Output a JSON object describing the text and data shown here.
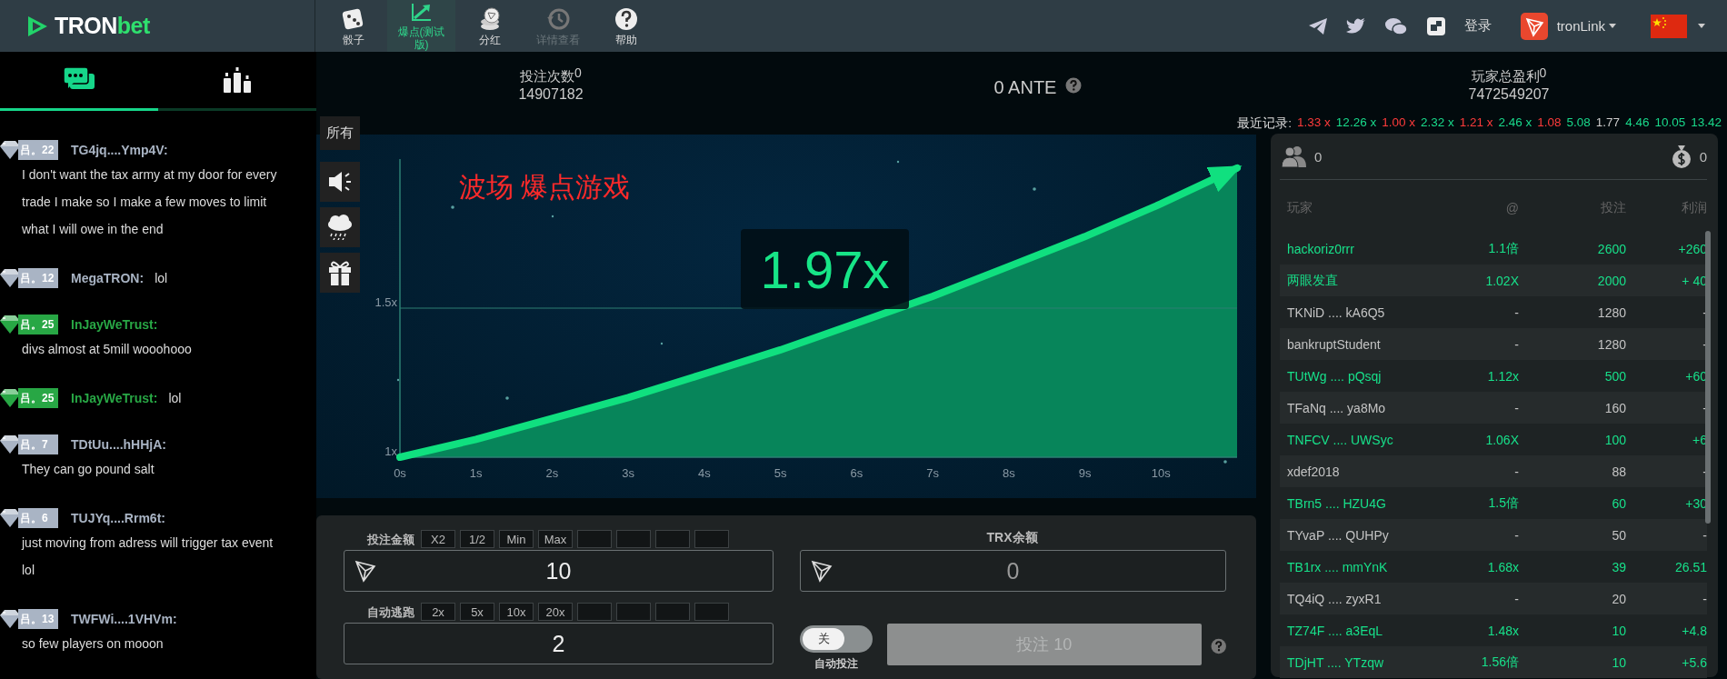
{
  "header": {
    "logo": {
      "main": "TRON",
      "accent": "bet"
    },
    "nav": [
      {
        "kind": "dice",
        "label": "骰子",
        "selected": false,
        "disabled": false
      },
      {
        "kind": "crash",
        "label": "爆点(测试版)",
        "selected": true,
        "disabled": false
      },
      {
        "kind": "coins",
        "label": "分红",
        "selected": false,
        "disabled": false
      },
      {
        "kind": "history",
        "label": "详情查看",
        "selected": false,
        "disabled": true
      },
      {
        "kind": "help",
        "label": "帮助",
        "selected": false,
        "disabled": false
      }
    ],
    "login": "登录",
    "wallet": "tronLink"
  },
  "sidebar": {
    "tabs": [
      {
        "kind": "chat",
        "selected": true
      },
      {
        "kind": "ranking",
        "selected": false
      }
    ],
    "messages": [
      {
        "level": "吕。22",
        "color": "#a9b4c4",
        "name": "TG4jq....Ymp4V:",
        "text": "I don't want the tax army at my door for every trade I make so I make a few moves to limit what I will owe in the end",
        "inline": false
      },
      {
        "level": "吕。12",
        "color": "#a9b4c4",
        "name": "MegaTRON:",
        "text": "lol",
        "inline": true
      },
      {
        "level": "吕。25",
        "color": "#28a745",
        "name": "InJayWeTrust:",
        "text": "divs almost at 5mill wooohooo",
        "inline": false
      },
      {
        "level": "吕。25",
        "color": "#28a745",
        "name": "InJayWeTrust:",
        "text": "lol",
        "inline": true
      },
      {
        "level": "吕。7",
        "color": "#a9b4c4",
        "name": "TDtUu....hHHjA:",
        "text": "They can go pound salt",
        "inline": false
      },
      {
        "level": "吕。6",
        "color": "#a9b4c4",
        "name": "TUJYq....Rrm6t:",
        "text": "just moving from adress will trigger tax event lol",
        "inline": false
      },
      {
        "level": "吕。13",
        "color": "#a9b4c4",
        "name": "TWFWi....1VHVm:",
        "text": "so few players on mooon",
        "inline": false
      }
    ]
  },
  "stats": [
    {
      "label": "投注次数",
      "badge": "0",
      "value": "14907182"
    },
    {
      "label": "玩家总盈利",
      "badge": "0",
      "value": "7472549207"
    }
  ],
  "ante": "0 ANTE",
  "recent": {
    "label": "最近记录:",
    "items": [
      {
        "text": "1.33 x",
        "color": "#ff3b3b"
      },
      {
        "text": "12.26 x",
        "color": "#19d98b"
      },
      {
        "text": "1.00 x",
        "color": "#ff3b3b"
      },
      {
        "text": "2.32 x",
        "color": "#19d98b"
      },
      {
        "text": "1.21 x",
        "color": "#ff3b3b"
      },
      {
        "text": "2.46 x",
        "color": "#19d98b"
      },
      {
        "text": "1.08",
        "color": "#ff3b3b"
      },
      {
        "text": "5.08",
        "color": "#19d98b"
      },
      {
        "text": "1.77",
        "color": "#cfcfcf"
      },
      {
        "text": "4.46",
        "color": "#19d98b"
      },
      {
        "text": "10.05",
        "color": "#19d98b"
      },
      {
        "text": "13.42",
        "color": "#19d98b"
      }
    ]
  },
  "game": {
    "filter": "所有",
    "title": "波场 爆点游戏",
    "multiplier": "1.97x",
    "chart_data": {
      "type": "area",
      "x": [
        0,
        1,
        2,
        3,
        4,
        5,
        6,
        7,
        8,
        9,
        10,
        11
      ],
      "series": [
        {
          "color": "#10e07f",
          "values": [
            1.0,
            1.06,
            1.13,
            1.2,
            1.28,
            1.36,
            1.45,
            1.54,
            1.64,
            1.74,
            1.85,
            1.97
          ]
        }
      ],
      "xlim": [
        0,
        11
      ],
      "ylim": [
        1,
        2
      ],
      "ref_lines": [
        {
          "axis": "y",
          "value": 1.5
        }
      ],
      "xticks": [
        {
          "value": 0,
          "label": "0s"
        },
        {
          "value": 1,
          "label": "1s"
        },
        {
          "value": 2,
          "label": "2s"
        },
        {
          "value": 3,
          "label": "3s"
        },
        {
          "value": 4,
          "label": "4s"
        },
        {
          "value": 5,
          "label": "5s"
        },
        {
          "value": 6,
          "label": "6s"
        },
        {
          "value": 7,
          "label": "7s"
        },
        {
          "value": 8,
          "label": "8s"
        },
        {
          "value": 9,
          "label": "9s"
        },
        {
          "value": 10,
          "label": "10s"
        }
      ],
      "yticks": [
        {
          "value": 1,
          "label": "1x"
        },
        {
          "value": 1.5,
          "label": "1.5x"
        }
      ]
    }
  },
  "bet": {
    "amount_label": "投注金额",
    "amount_chips": [
      "X2",
      "1/2",
      "Min",
      "Max"
    ],
    "amount": "10",
    "balance_label": "TRX余额",
    "balance": "0",
    "escape_label": "自动逃跑",
    "escape_chips": [
      "2x",
      "5x",
      "10x",
      "20x"
    ],
    "escape": "2",
    "auto_bet": {
      "on": false,
      "state_text": "关",
      "label": "自动投注"
    },
    "button": "投注 10"
  },
  "players": {
    "count": "0",
    "pot": "0",
    "columns": [
      "玩家",
      "@",
      "投注",
      "利润"
    ],
    "rows": [
      {
        "win": true,
        "cells": [
          "hackoriz0rrr",
          "1.1倍",
          "2600",
          "+260"
        ]
      },
      {
        "win": true,
        "cells": [
          "两眼发直",
          "1.02X",
          "2000",
          "+ 40"
        ]
      },
      {
        "win": false,
        "cells": [
          "TKNiD .... kA6Q5",
          "-",
          "1280",
          "-"
        ]
      },
      {
        "win": false,
        "cells": [
          "bankruptStudent",
          "-",
          "1280",
          "-"
        ]
      },
      {
        "win": true,
        "cells": [
          "TUtWg .... pQsqj",
          "1.12x",
          "500",
          "+60"
        ]
      },
      {
        "win": false,
        "cells": [
          "TFaNq .... ya8Mo",
          "-",
          "160",
          "-"
        ]
      },
      {
        "win": true,
        "cells": [
          "TNFCV .... UWSyc",
          "1.06X",
          "100",
          "+6"
        ]
      },
      {
        "win": false,
        "cells": [
          "xdef2018",
          "-",
          "88",
          "-"
        ]
      },
      {
        "win": true,
        "cells": [
          "TBrn5 .... HZU4G",
          "1.5倍",
          "60",
          "+30"
        ]
      },
      {
        "win": false,
        "cells": [
          "TYvaP .... QUHPy",
          "-",
          "50",
          "-"
        ]
      },
      {
        "win": true,
        "cells": [
          "TB1rx .... mmYnK",
          "1.68x",
          "39",
          "26.51"
        ]
      },
      {
        "win": false,
        "cells": [
          "TQ4iQ .... zyxR1",
          "-",
          "20",
          "-"
        ]
      },
      {
        "win": true,
        "cells": [
          "TZ74F .... a3EqL",
          "1.48x",
          "10",
          "+4.8"
        ]
      },
      {
        "win": true,
        "cells": [
          "TDjHT .... YTzqw",
          "1.56倍",
          "10",
          "+5.6"
        ]
      }
    ]
  }
}
